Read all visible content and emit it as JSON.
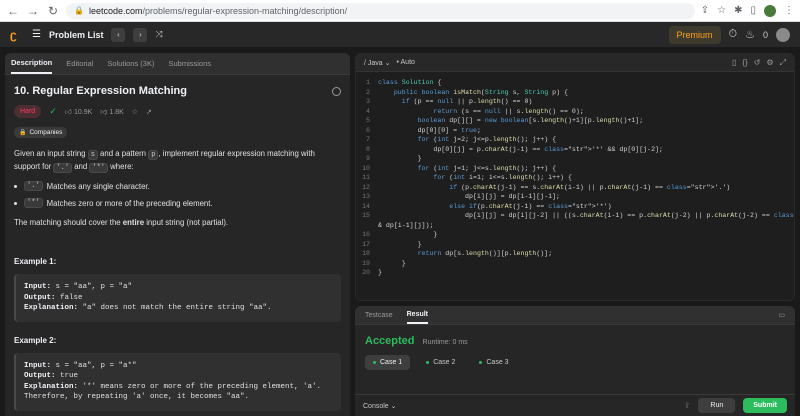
{
  "browser": {
    "url_host": "leetcode.com",
    "url_path": "/problems/regular-expression-matching/description/"
  },
  "topnav": {
    "problem_list": "Problem List",
    "premium": "Premium",
    "streak": "0"
  },
  "tabs": [
    "Description",
    "Editorial",
    "Solutions (3K)",
    "Submissions"
  ],
  "problem": {
    "title": "10. Regular Expression Matching",
    "difficulty": "Hard",
    "likes": "10.9K",
    "dislikes": "1.8K",
    "companies": "Companies",
    "desc_1": "Given an input string ",
    "desc_s": "s",
    "desc_2": " and a pattern ",
    "desc_p": "p",
    "desc_3": ", implement regular expression matching with support for ",
    "desc_dot": "'.'",
    "desc_and": " and ",
    "desc_star": "'*'",
    "desc_4": " where:",
    "bullet1_code": "'.'",
    "bullet1_text": "Matches any single character.",
    "bullet2_code": "'*'",
    "bullet2_text": "Matches zero or more of the preceding element.",
    "cover_1": "The matching should cover the ",
    "cover_bold": "entire",
    "cover_2": " input string (not partial).",
    "example1_title": "Example 1:",
    "example1_input_label": "Input:",
    "example1_input": " s = \"aa\", p = \"a\"",
    "example1_output_label": "Output:",
    "example1_output": " false",
    "example1_expl_label": "Explanation:",
    "example1_expl": " \"a\" does not match the entire string \"aa\".",
    "example2_title": "Example 2:",
    "example2_input_label": "Input:",
    "example2_input": " s = \"aa\", p = \"a*\"",
    "example2_output_label": "Output:",
    "example2_output": " true",
    "example2_expl_label": "Explanation:",
    "example2_expl": " '*' means zero or more of the preceding element, 'a'.",
    "example2_expl2": "Therefore, by repeating 'a' once, it becomes \"aa\"."
  },
  "editor": {
    "language": "Java",
    "autocomplete": "Auto",
    "lines": [
      "class Solution {",
      "    public boolean isMatch(String s, String p) {",
      "      if (p == null || p.length() == 0)",
      "              return (s == null || s.length() == 0);",
      "          boolean dp[][] = new boolean[s.length()+1][p.length()+1];",
      "          dp[0][0] = true;",
      "          for (int j=2; j<=p.length(); j++) {",
      "              dp[0][j] = p.charAt(j-1) == '*' && dp[0][j-2];",
      "          }",
      "          for (int j=1; j<=s.length(); j++) {",
      "              for (int i=1; i<=s.length(); i++) {",
      "                  if (p.charAt(j-1) == s.charAt(i-1) || p.charAt(j-1) == '.')",
      "                      dp[i][j] = dp[i-1][j-1];",
      "                  else if(p.charAt(j-1) == '*')",
      "                      dp[i][j] = dp[i][j-2] || ((s.charAt(i-1) == p.charAt(j-2) || p.charAt(j-2) == '.') &",
      "& dp[i-1][j]);",
      "              }",
      "          }",
      "          return dp[s.length()][p.length()];",
      "      }",
      "}"
    ],
    "line_numbers": [
      "1",
      "2",
      "3",
      "4",
      "5",
      "6",
      "7",
      "8",
      "9",
      "10",
      "11",
      "12",
      "13",
      "14",
      "15",
      "",
      "16",
      "17",
      "18",
      "19",
      "20"
    ]
  },
  "result": {
    "tabs": [
      "Testcase",
      "Result"
    ],
    "status": "Accepted",
    "runtime": "Runtime: 0 ms",
    "cases": [
      "Case 1",
      "Case 2",
      "Case 3"
    ],
    "console": "Console",
    "run": "Run",
    "submit": "Submit"
  }
}
